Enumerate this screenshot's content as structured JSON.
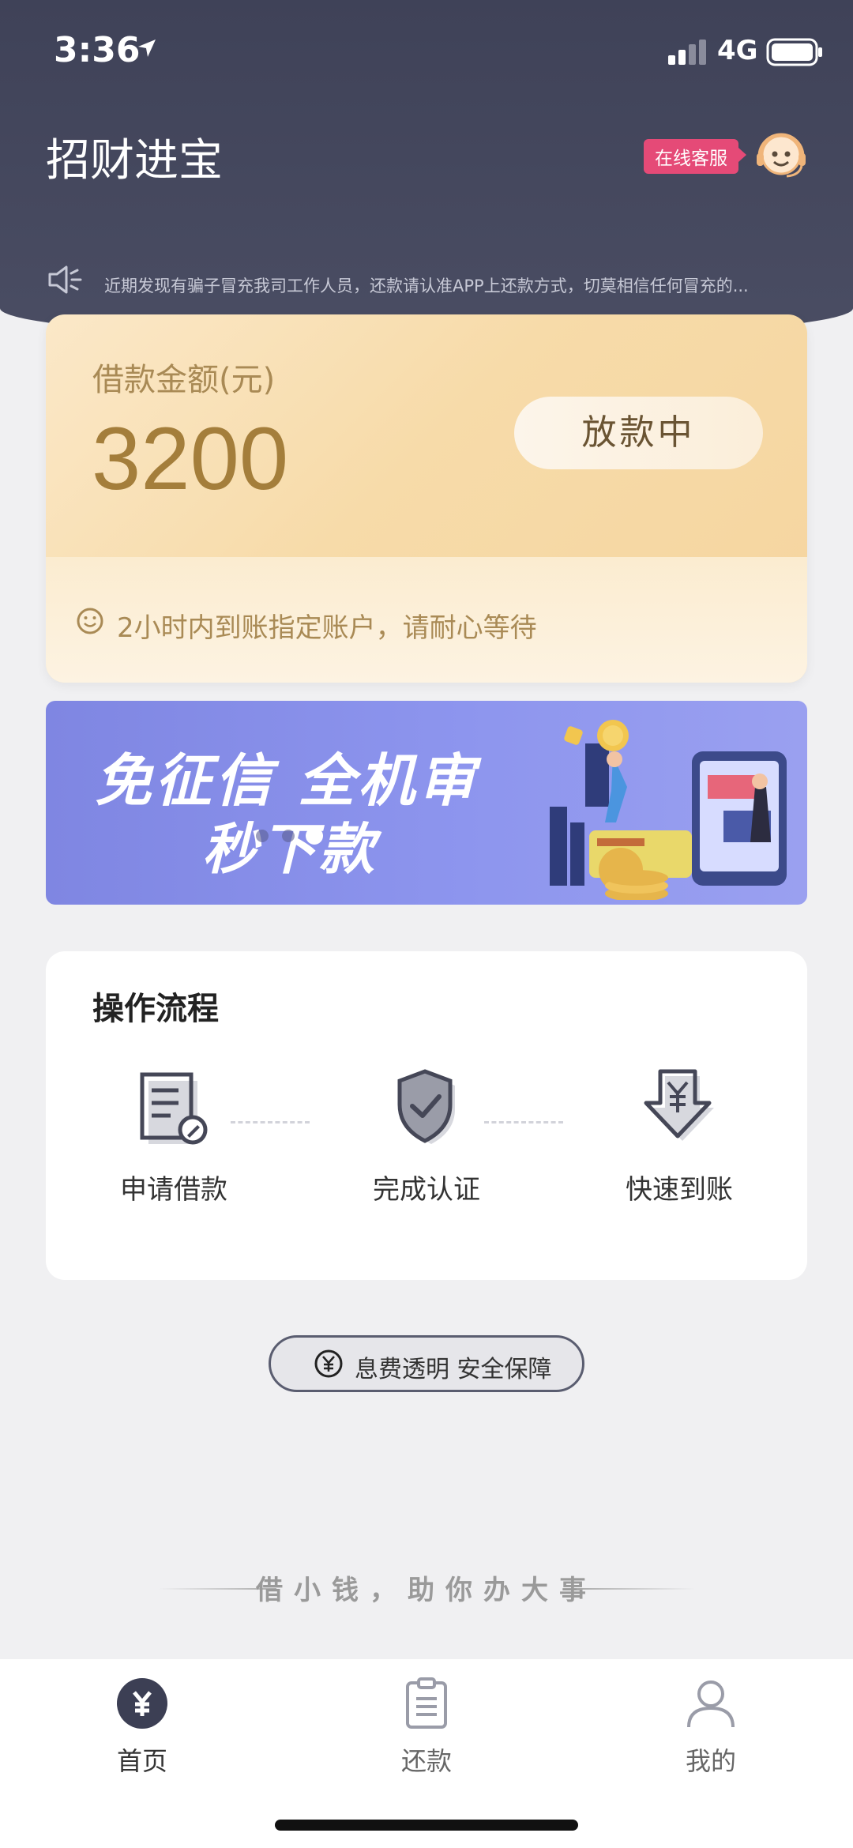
{
  "status_bar": {
    "time": "3:36",
    "network": "4G"
  },
  "header": {
    "title": "招财进宝",
    "customer_service_label": "在线客服",
    "notice": "近期发现有骗子冒充我司工作人员，还款请认准APP上还款方式，切莫相信任何冒充的..."
  },
  "loan_card": {
    "label": "借款金额(元)",
    "amount": "3200",
    "status": "放款中",
    "note": "2小时内到账指定账户，请耐心等待"
  },
  "banner": {
    "line1": "免征信  全机审",
    "line2": "秒下款",
    "current_slide": 3,
    "total_slides": 3
  },
  "process": {
    "title": "操作流程",
    "steps": [
      {
        "label": "申请借款",
        "icon": "document-edit-icon"
      },
      {
        "label": "完成认证",
        "icon": "shield-check-icon"
      },
      {
        "label": "快速到账",
        "icon": "yuan-arrow-down-icon"
      }
    ]
  },
  "trust": {
    "label": "息费透明 安全保障",
    "icon": "yuan-circle-icon"
  },
  "slogan": "借小钱，助你办大事",
  "tabbar": {
    "items": [
      {
        "label": "首页",
        "icon": "yuan-circle-icon",
        "active": true
      },
      {
        "label": "还款",
        "icon": "clipboard-icon",
        "active": false
      },
      {
        "label": "我的",
        "icon": "user-icon",
        "active": false
      }
    ]
  },
  "colors": {
    "header": "#3f4258",
    "gold": "#a47e3b",
    "badge": "#e54a77",
    "banner": "#8d95ee"
  }
}
